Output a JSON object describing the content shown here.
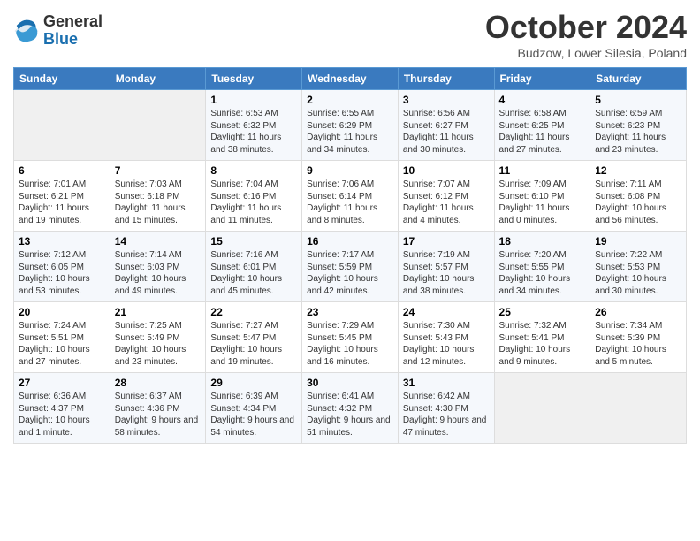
{
  "logo": {
    "general": "General",
    "blue": "Blue"
  },
  "header": {
    "month": "October 2024",
    "location": "Budzow, Lower Silesia, Poland"
  },
  "weekdays": [
    "Sunday",
    "Monday",
    "Tuesday",
    "Wednesday",
    "Thursday",
    "Friday",
    "Saturday"
  ],
  "weeks": [
    [
      {
        "day": "",
        "info": ""
      },
      {
        "day": "",
        "info": ""
      },
      {
        "day": "1",
        "info": "Sunrise: 6:53 AM\nSunset: 6:32 PM\nDaylight: 11 hours and 38 minutes."
      },
      {
        "day": "2",
        "info": "Sunrise: 6:55 AM\nSunset: 6:29 PM\nDaylight: 11 hours and 34 minutes."
      },
      {
        "day": "3",
        "info": "Sunrise: 6:56 AM\nSunset: 6:27 PM\nDaylight: 11 hours and 30 minutes."
      },
      {
        "day": "4",
        "info": "Sunrise: 6:58 AM\nSunset: 6:25 PM\nDaylight: 11 hours and 27 minutes."
      },
      {
        "day": "5",
        "info": "Sunrise: 6:59 AM\nSunset: 6:23 PM\nDaylight: 11 hours and 23 minutes."
      }
    ],
    [
      {
        "day": "6",
        "info": "Sunrise: 7:01 AM\nSunset: 6:21 PM\nDaylight: 11 hours and 19 minutes."
      },
      {
        "day": "7",
        "info": "Sunrise: 7:03 AM\nSunset: 6:18 PM\nDaylight: 11 hours and 15 minutes."
      },
      {
        "day": "8",
        "info": "Sunrise: 7:04 AM\nSunset: 6:16 PM\nDaylight: 11 hours and 11 minutes."
      },
      {
        "day": "9",
        "info": "Sunrise: 7:06 AM\nSunset: 6:14 PM\nDaylight: 11 hours and 8 minutes."
      },
      {
        "day": "10",
        "info": "Sunrise: 7:07 AM\nSunset: 6:12 PM\nDaylight: 11 hours and 4 minutes."
      },
      {
        "day": "11",
        "info": "Sunrise: 7:09 AM\nSunset: 6:10 PM\nDaylight: 11 hours and 0 minutes."
      },
      {
        "day": "12",
        "info": "Sunrise: 7:11 AM\nSunset: 6:08 PM\nDaylight: 10 hours and 56 minutes."
      }
    ],
    [
      {
        "day": "13",
        "info": "Sunrise: 7:12 AM\nSunset: 6:05 PM\nDaylight: 10 hours and 53 minutes."
      },
      {
        "day": "14",
        "info": "Sunrise: 7:14 AM\nSunset: 6:03 PM\nDaylight: 10 hours and 49 minutes."
      },
      {
        "day": "15",
        "info": "Sunrise: 7:16 AM\nSunset: 6:01 PM\nDaylight: 10 hours and 45 minutes."
      },
      {
        "day": "16",
        "info": "Sunrise: 7:17 AM\nSunset: 5:59 PM\nDaylight: 10 hours and 42 minutes."
      },
      {
        "day": "17",
        "info": "Sunrise: 7:19 AM\nSunset: 5:57 PM\nDaylight: 10 hours and 38 minutes."
      },
      {
        "day": "18",
        "info": "Sunrise: 7:20 AM\nSunset: 5:55 PM\nDaylight: 10 hours and 34 minutes."
      },
      {
        "day": "19",
        "info": "Sunrise: 7:22 AM\nSunset: 5:53 PM\nDaylight: 10 hours and 30 minutes."
      }
    ],
    [
      {
        "day": "20",
        "info": "Sunrise: 7:24 AM\nSunset: 5:51 PM\nDaylight: 10 hours and 27 minutes."
      },
      {
        "day": "21",
        "info": "Sunrise: 7:25 AM\nSunset: 5:49 PM\nDaylight: 10 hours and 23 minutes."
      },
      {
        "day": "22",
        "info": "Sunrise: 7:27 AM\nSunset: 5:47 PM\nDaylight: 10 hours and 19 minutes."
      },
      {
        "day": "23",
        "info": "Sunrise: 7:29 AM\nSunset: 5:45 PM\nDaylight: 10 hours and 16 minutes."
      },
      {
        "day": "24",
        "info": "Sunrise: 7:30 AM\nSunset: 5:43 PM\nDaylight: 10 hours and 12 minutes."
      },
      {
        "day": "25",
        "info": "Sunrise: 7:32 AM\nSunset: 5:41 PM\nDaylight: 10 hours and 9 minutes."
      },
      {
        "day": "26",
        "info": "Sunrise: 7:34 AM\nSunset: 5:39 PM\nDaylight: 10 hours and 5 minutes."
      }
    ],
    [
      {
        "day": "27",
        "info": "Sunrise: 6:36 AM\nSunset: 4:37 PM\nDaylight: 10 hours and 1 minute."
      },
      {
        "day": "28",
        "info": "Sunrise: 6:37 AM\nSunset: 4:36 PM\nDaylight: 9 hours and 58 minutes."
      },
      {
        "day": "29",
        "info": "Sunrise: 6:39 AM\nSunset: 4:34 PM\nDaylight: 9 hours and 54 minutes."
      },
      {
        "day": "30",
        "info": "Sunrise: 6:41 AM\nSunset: 4:32 PM\nDaylight: 9 hours and 51 minutes."
      },
      {
        "day": "31",
        "info": "Sunrise: 6:42 AM\nSunset: 4:30 PM\nDaylight: 9 hours and 47 minutes."
      },
      {
        "day": "",
        "info": ""
      },
      {
        "day": "",
        "info": ""
      }
    ]
  ]
}
